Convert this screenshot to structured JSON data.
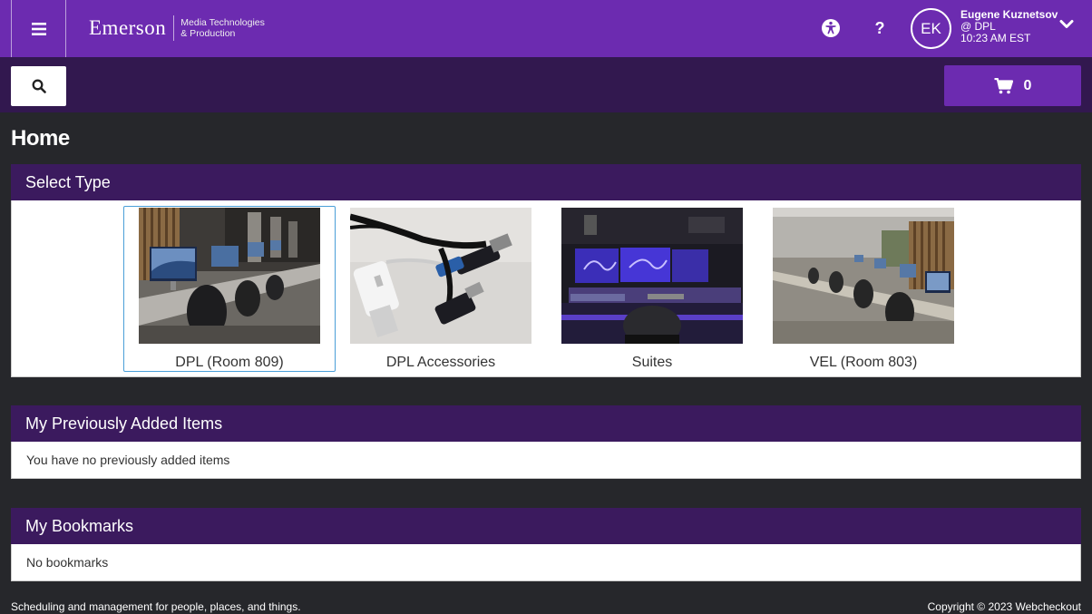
{
  "header": {
    "logo_word": "Emerson",
    "logo_sub_1": "Media Technologies",
    "logo_sub_2": "& Production",
    "help_label": "?",
    "avatar_initials": "EK",
    "user_name": "Eugene Kuznetsov",
    "user_location": "@ DPL",
    "user_time": "10:23 AM EST"
  },
  "toolbar": {
    "cart_count": "0"
  },
  "page": {
    "title": "Home"
  },
  "select_type": {
    "heading": "Select Type",
    "items": [
      {
        "label": "DPL (Room 809)",
        "selected": true
      },
      {
        "label": "DPL Accessories",
        "selected": false
      },
      {
        "label": "Suites",
        "selected": false
      },
      {
        "label": "VEL (Room 803)",
        "selected": false
      }
    ]
  },
  "previously_added": {
    "heading": "My Previously Added Items",
    "empty_text": "You have no previously added items"
  },
  "bookmarks": {
    "heading": "My Bookmarks",
    "empty_text": "No bookmarks"
  },
  "footer": {
    "tagline": "Scheduling and management for people, places, and things.",
    "copyright": "Copyright © 2023 Webcheckout"
  },
  "colors": {
    "brand_purple": "#6c2bb0",
    "dark_purple": "#32184f",
    "panel_header": "#3b1a5e",
    "background": "#26272b"
  }
}
